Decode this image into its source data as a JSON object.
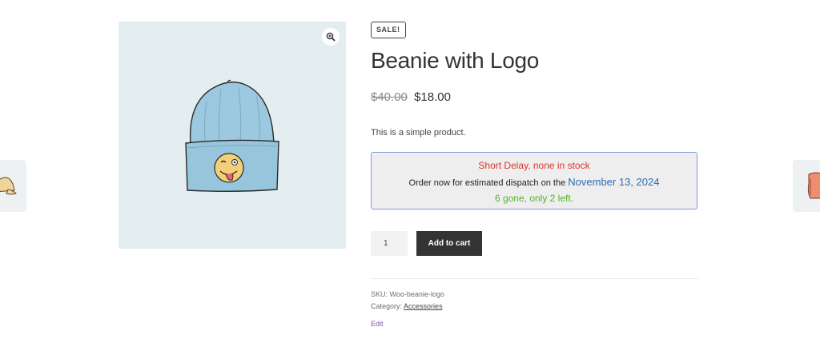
{
  "product": {
    "sale_badge": "SALE!",
    "title": "Beanie with Logo",
    "price_old": "$40.00",
    "price_new": "$18.00",
    "description": "This is a simple product."
  },
  "stock_notice": {
    "status": "Short Delay, none in stock",
    "dispatch_prefix": "Order now for estimated dispatch on the",
    "dispatch_date": "November 13, 2024",
    "remaining": "6 gone, only 2 left."
  },
  "cart": {
    "quantity": "1",
    "add_to_cart_label": "Add to cart"
  },
  "meta": {
    "sku_label": "SKU:",
    "sku_value": "Woo-beanie-logo",
    "category_label": "Category:",
    "category_value": "Accessories",
    "edit_label": "Edit"
  },
  "icons": {
    "zoom": "magnifier-plus-icon",
    "prev_product": "cap-thumbnail",
    "next_product": "hoodie-thumbnail"
  },
  "colors": {
    "status_red": "#e0322c",
    "date_blue": "#2d6bb3",
    "remaining_green": "#55b22c",
    "button_dark": "#333333",
    "edit_purple": "#7f54b3"
  }
}
